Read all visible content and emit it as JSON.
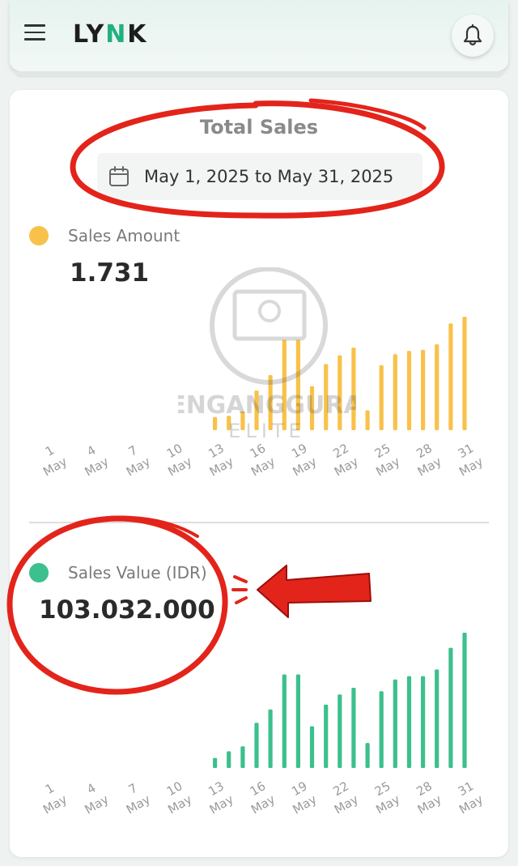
{
  "header": {
    "logo_text": "LYNK",
    "menu_icon": "hamburger-menu-icon",
    "bell_icon": "bell-icon"
  },
  "card": {
    "title": "Total Sales",
    "date_range": "May 1, 2025 to May 31, 2025",
    "calendar_icon": "calendar-icon"
  },
  "watermark": {
    "line1": "PENGANGGURAN",
    "line2": "ELITE"
  },
  "colors": {
    "amount": "#f8c24a",
    "value": "#3cc08d",
    "annotation_red": "#e3241b"
  },
  "chart_data": [
    {
      "type": "bar",
      "title": "Sales Amount",
      "total": "1.731",
      "x_day": [
        1,
        2,
        3,
        4,
        5,
        6,
        7,
        8,
        9,
        10,
        11,
        12,
        13,
        14,
        15,
        16,
        17,
        18,
        19,
        20,
        21,
        22,
        23,
        24,
        25,
        26,
        27,
        28,
        29,
        30,
        31
      ],
      "tick_labels": [
        [
          "1",
          "May"
        ],
        [
          "4",
          "May"
        ],
        [
          "7",
          "May"
        ],
        [
          "10",
          "May"
        ],
        [
          "13",
          "May"
        ],
        [
          "16",
          "May"
        ],
        [
          "19",
          "May"
        ],
        [
          "22",
          "May"
        ],
        [
          "25",
          "May"
        ],
        [
          "28",
          "May"
        ],
        [
          "31",
          "May"
        ]
      ],
      "tick_days": [
        1,
        4,
        7,
        10,
        13,
        16,
        19,
        22,
        25,
        28,
        31
      ],
      "series": [
        {
          "values": [
            0,
            0,
            0,
            0,
            0,
            0,
            0,
            0,
            0,
            0,
            0,
            0,
            12,
            13,
            17,
            36,
            50,
            82,
            82,
            40,
            60,
            68,
            75,
            18,
            59,
            69,
            72,
            73,
            78,
            97,
            103,
            66
          ]
        }
      ]
    },
    {
      "type": "bar",
      "title": "Sales Value (IDR)",
      "total": "103.032.000",
      "x_day": [
        1,
        2,
        3,
        4,
        5,
        6,
        7,
        8,
        9,
        10,
        11,
        12,
        13,
        14,
        15,
        16,
        17,
        18,
        19,
        20,
        21,
        22,
        23,
        24,
        25,
        26,
        27,
        28,
        29,
        30,
        31
      ],
      "tick_labels": [
        [
          "1",
          "May"
        ],
        [
          "4",
          "May"
        ],
        [
          "7",
          "May"
        ],
        [
          "10",
          "May"
        ],
        [
          "13",
          "May"
        ],
        [
          "16",
          "May"
        ],
        [
          "19",
          "May"
        ],
        [
          "22",
          "May"
        ],
        [
          "25",
          "May"
        ],
        [
          "28",
          "May"
        ],
        [
          "31",
          "May"
        ]
      ],
      "tick_days": [
        1,
        4,
        7,
        10,
        13,
        16,
        19,
        22,
        25,
        28,
        31
      ],
      "series": [
        {
          "values": [
            0,
            0,
            0,
            0,
            0,
            0,
            0,
            0,
            0,
            0,
            0,
            0,
            6,
            10,
            13,
            27,
            35,
            56,
            56,
            25,
            38,
            44,
            48,
            15,
            46,
            53,
            55,
            55,
            59,
            72,
            81,
            52
          ]
        }
      ]
    }
  ]
}
